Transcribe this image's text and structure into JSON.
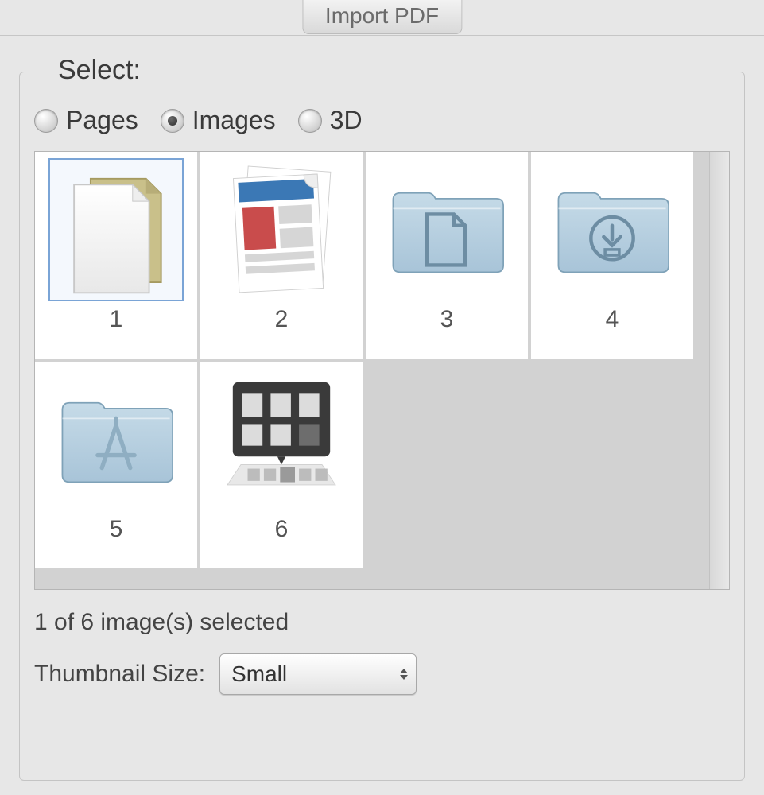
{
  "dialog": {
    "title": "Import PDF",
    "group_label": "Select:",
    "radios": [
      {
        "value": "pages",
        "label": "Pages",
        "selected": false
      },
      {
        "value": "images",
        "label": "Images",
        "selected": true
      },
      {
        "value": "3d",
        "label": "3D",
        "selected": false
      }
    ],
    "items": [
      {
        "index": 1,
        "label": "1",
        "kind": "documents-stack",
        "selected": true
      },
      {
        "index": 2,
        "label": "2",
        "kind": "webpage-stack",
        "selected": false
      },
      {
        "index": 3,
        "label": "3",
        "kind": "folder-documents",
        "selected": false
      },
      {
        "index": 4,
        "label": "4",
        "kind": "folder-downloads",
        "selected": false
      },
      {
        "index": 5,
        "label": "5",
        "kind": "folder-apps",
        "selected": false
      },
      {
        "index": 6,
        "label": "6",
        "kind": "dock-stack",
        "selected": false
      }
    ],
    "status": "1 of 6 image(s) selected",
    "thumb_label": "Thumbnail Size:",
    "thumb_size": "Small",
    "folder_color": "#a8c4d8"
  }
}
